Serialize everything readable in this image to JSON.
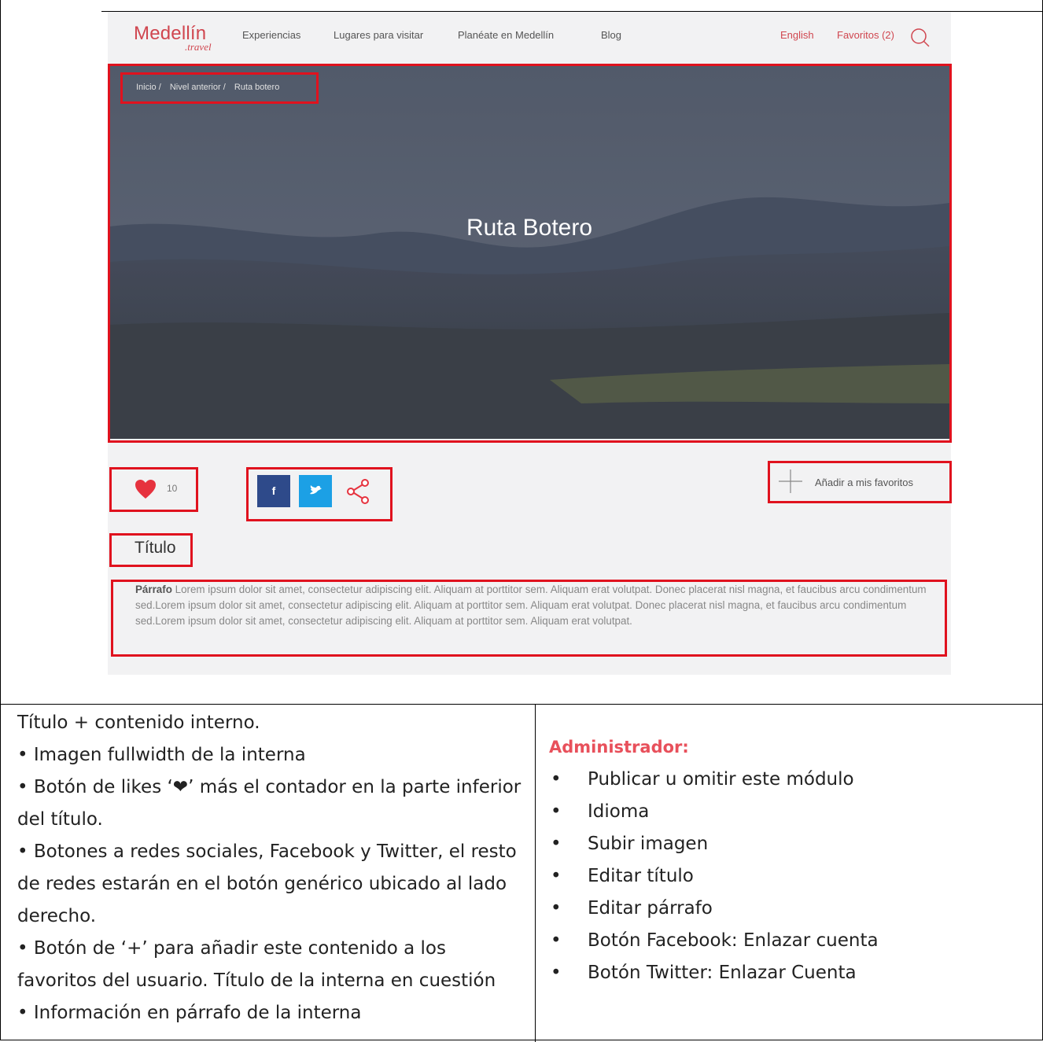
{
  "nav": {
    "logo": "Medellín",
    "logo_sub": ".travel",
    "links": [
      "Experiencias",
      "Lugares para visitar",
      "Planéate en Medellín",
      "Blog"
    ],
    "language": "English",
    "favorites": "Favoritos (2)"
  },
  "hero": {
    "title": "Ruta Botero",
    "breadcrumbs": [
      "Inicio /",
      "Nivel anterior /",
      "Ruta botero"
    ]
  },
  "likes": {
    "count": "10"
  },
  "social": {
    "facebook_label": "f"
  },
  "favorite_button": {
    "label": "Añadir a mis favoritos"
  },
  "content": {
    "title": "Título",
    "paragraph_label": "Párrafo",
    "paragraph_text": "Lorem ipsum dolor sit amet, consectetur adipiscing elit. Aliquam at porttitor sem. Aliquam erat volutpat. Donec placerat nisl magna, et faucibus arcu condimentum sed.Lorem ipsum dolor sit amet, consectetur adipiscing elit. Aliquam at porttitor sem. Aliquam erat volutpat. Donec placerat nisl magna, et faucibus arcu condimentum sed.Lorem ipsum dolor sit amet, consectetur adipiscing elit. Aliquam at porttitor sem. Aliquam erat volutpat."
  },
  "notes": {
    "lines": [
      "Título + contenido interno.",
      "• Imagen fullwidth de la interna",
      "• Botón de likes ‘❤’ más el contador en la parte inferior del título.",
      "• Botones a redes sociales, Facebook y Twitter, el resto de redes estarán en el botón genérico ubicado al lado derecho.",
      "• Botón de ‘+’ para añadir este contenido a los favoritos del usuario. Título de la interna en cuestión",
      "• Información en párrafo de la interna"
    ]
  },
  "admin": {
    "heading": "Administrador:",
    "bullet": "•",
    "items": [
      "Publicar u omitir este módulo",
      "Idioma",
      "Subir imagen",
      "Editar título",
      "Editar párrafo",
      "Botón Facebook: Enlazar cuenta",
      "Botón Twitter: Enlazar Cuenta"
    ]
  },
  "colors": {
    "accent": "#d0464f",
    "annotation_box": "#e0121e",
    "facebook": "#2e4a8a",
    "twitter": "#1ca0e5",
    "admin_heading": "#e8505b"
  }
}
